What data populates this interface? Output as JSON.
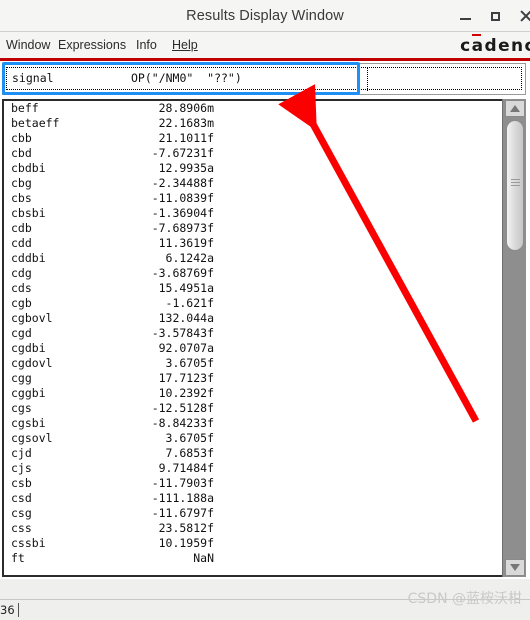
{
  "window": {
    "title": "Results Display Window",
    "controls": [
      {
        "name": "minimize",
        "label": "–"
      },
      {
        "name": "maximize",
        "label": "□"
      },
      {
        "name": "close",
        "label": "✕"
      }
    ]
  },
  "menubar": {
    "items": [
      "Window",
      "Expressions",
      "Info",
      "Help"
    ],
    "help_mnemonic": "H"
  },
  "brand": {
    "text_before": "c",
    "text_macron": "a",
    "text_after": "denc"
  },
  "expression_row": {
    "name": "signal",
    "value": "OP(\"/NM0\"  \"??\")"
  },
  "results": {
    "rows": [
      {
        "name": "beff",
        "value": "28.8906m"
      },
      {
        "name": "betaeff",
        "value": "22.1683m"
      },
      {
        "name": "cbb",
        "value": "21.1011f"
      },
      {
        "name": "cbd",
        "value": "-7.67231f"
      },
      {
        "name": "cbdbi",
        "value": "12.9935a"
      },
      {
        "name": "cbg",
        "value": "-2.34488f"
      },
      {
        "name": "cbs",
        "value": "-11.0839f"
      },
      {
        "name": "cbsbi",
        "value": "-1.36904f"
      },
      {
        "name": "cdb",
        "value": "-7.68973f"
      },
      {
        "name": "cdd",
        "value": "11.3619f"
      },
      {
        "name": "cddbi",
        "value": "6.1242a"
      },
      {
        "name": "cdg",
        "value": "-3.68769f"
      },
      {
        "name": "cds",
        "value": "15.4951a"
      },
      {
        "name": "cgb",
        "value": "-1.621f"
      },
      {
        "name": "cgbovl",
        "value": "132.044a"
      },
      {
        "name": "cgd",
        "value": "-3.57843f"
      },
      {
        "name": "cgdbi",
        "value": "92.0707a"
      },
      {
        "name": "cgdovl",
        "value": "3.6705f"
      },
      {
        "name": "cgg",
        "value": "17.7123f"
      },
      {
        "name": "cggbi",
        "value": "10.2392f"
      },
      {
        "name": "cgs",
        "value": "-12.5128f"
      },
      {
        "name": "cgsbi",
        "value": "-8.84233f"
      },
      {
        "name": "cgsovl",
        "value": "3.6705f"
      },
      {
        "name": "cjd",
        "value": "7.6853f"
      },
      {
        "name": "cjs",
        "value": "9.71484f"
      },
      {
        "name": "csb",
        "value": "-11.7903f"
      },
      {
        "name": "csd",
        "value": "-111.188a"
      },
      {
        "name": "csg",
        "value": "-11.6797f"
      },
      {
        "name": "css",
        "value": "23.5812f"
      },
      {
        "name": "cssbi",
        "value": "10.1959f"
      },
      {
        "name": "ft",
        "value": "NaN"
      }
    ]
  },
  "statusbar": {
    "value": "36"
  },
  "watermark": {
    "text": "CSDN @蓝桉沃柑"
  },
  "colors": {
    "brand_red": "#c00000",
    "annotation_blue": "#1e90f5",
    "annotation_red": "#fb0000",
    "titlebar_bg": "#f5f5f4"
  }
}
